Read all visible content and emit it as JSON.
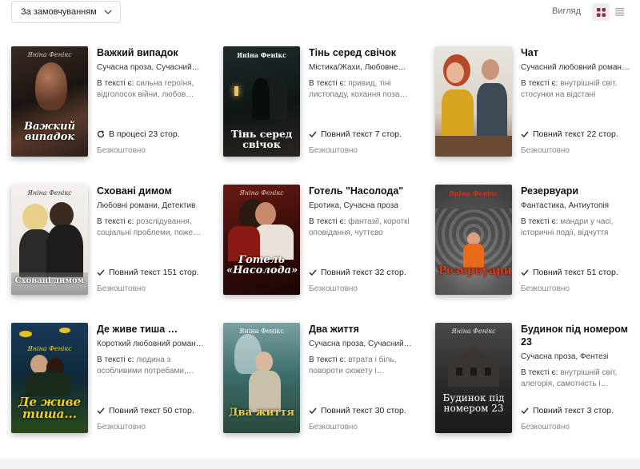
{
  "toolbar": {
    "sort_label": "За замовчуванням",
    "view_label": "Вигляд",
    "grid_icon": "grid-icon",
    "list_icon": "list-icon",
    "grid_color": "#8b2c5a"
  },
  "tags_prefix": "В тексті є:",
  "books": [
    {
      "title": "Важкий випадок",
      "genre": "Сучасна проза, Сучасний…",
      "tags": "сильна героїня, відголосок війни, любов…",
      "status": "В процесі 23 стор.",
      "status_icon": "refresh-icon",
      "price": "Безкоштовно",
      "cover_author": "Яніна Фенікс",
      "cover_title": "Важкий випадок"
    },
    {
      "title": "Тінь серед свічок",
      "genre": "Містика/Жахи, Любовне…",
      "tags": "привид, тіні листопаду, кохання поза…",
      "status": "Повний текст 7 стор.",
      "status_icon": "check-icon",
      "price": "Безкоштовно",
      "cover_author": "Яніна Фенікс",
      "cover_title": "Тінь серед свічок"
    },
    {
      "title": "Чат",
      "genre": "Сучасний любовний роман…",
      "tags": "внутрішній світ, стосунки на відстані",
      "status": "Повний текст 22 стор.",
      "status_icon": "check-icon",
      "price": "Безкоштовно",
      "cover_author": "",
      "cover_title": ""
    },
    {
      "title": "Сховані димом",
      "genre": "Любовні романи, Детектив",
      "tags": "розслідування, соціальні проблеми, поже…",
      "status": "Повний текст 151 стор.",
      "status_icon": "check-icon",
      "price": "Безкоштовно",
      "cover_author": "Яніна Фенікс",
      "cover_title": "Сховані димом"
    },
    {
      "title": "Готель \"Насолода\"",
      "genre": "Еротика, Сучасна проза",
      "tags": "фантазії, короткі оповідання, чуттєво",
      "status": "Повний текст 32 стор.",
      "status_icon": "check-icon",
      "price": "Безкоштовно",
      "cover_author": "Яніна Фенікс",
      "cover_title": "Готель «Насолода»"
    },
    {
      "title": "Резервуари",
      "genre": "Фантастика, Антиутопія",
      "tags": "мандри у часі, історичні події, відчуття",
      "status": "Повний текст 51 стор.",
      "status_icon": "check-icon",
      "price": "Безкоштовно",
      "cover_author": "Яніна Фенікс",
      "cover_title": "Резервуари"
    },
    {
      "title": "Де живе тиша …",
      "genre": "Короткий любовний роман…",
      "tags": "людина з особливими потребами,…",
      "status": "Повний текст 50 стор.",
      "status_icon": "check-icon",
      "price": "Безкоштовно",
      "cover_author": "Яніна Фенікс",
      "cover_title": "Де живе тиша..."
    },
    {
      "title": "Два життя",
      "genre": "Сучасна проза, Сучасний…",
      "tags": "втрата і біль, повороти сюжету і…",
      "status": "Повний текст 30 стор.",
      "status_icon": "check-icon",
      "price": "Безкоштовно",
      "cover_author": "Яніна Фенікс",
      "cover_title": "Два життя"
    },
    {
      "title": "Будинок під номером 23",
      "genre": "Сучасна проза, Фентезі",
      "tags": "внутрішній світ, алегорія, самотність і…",
      "status": "Повний текст 3 стор.",
      "status_icon": "check-icon",
      "price": "Безкоштовно",
      "cover_author": "Яніна Фенікс",
      "cover_title": "Будинок під номером 23"
    }
  ]
}
